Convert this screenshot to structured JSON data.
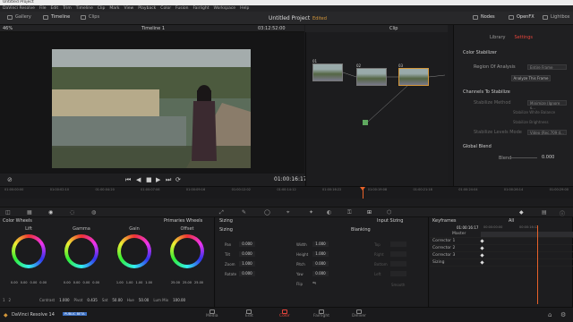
{
  "window": {
    "title": "Untitled Project"
  },
  "menu": [
    "DaVinci Resolve",
    "File",
    "Edit",
    "Trim",
    "Timeline",
    "Clip",
    "Mark",
    "View",
    "Playback",
    "Color",
    "Fusion",
    "Fairlight",
    "Workspace",
    "Help"
  ],
  "topbar": {
    "gallery": "Gallery",
    "timeline": "Timeline",
    "clips": "Clips",
    "project": "Untitled Project",
    "edited": "Edited",
    "nodes": "Nodes",
    "openfx": "OpenFX",
    "lightbox": "Lightbox"
  },
  "viewer": {
    "zoom": "46%",
    "timeline_name": "Timeline 1",
    "timecode_top": "03:12:52:00",
    "clip_label": "Clip",
    "timecode": "01:00:16:17"
  },
  "nodes": [
    {
      "num": "01"
    },
    {
      "num": "02"
    },
    {
      "num": "03"
    }
  ],
  "settings": {
    "tab_library": "Library",
    "tab_settings": "Settings",
    "fx_name": "Color Stabilizer",
    "region_label": "Region Of Analysis",
    "region_value": "Entire Frame",
    "analyze": "Analyze This Frame",
    "section_channels": "Channels To Stabilize",
    "method_label": "Stabilize Method",
    "method_value": "Minimize (Ignore s...",
    "opt1": "Stabilize White Balance",
    "opt2": "Stabilize Brightness",
    "levels_label": "Stabilize Levels Mode",
    "levels_value": "Video (Rec.709 d...",
    "section_global": "Global Blend",
    "blend_label": "Blend",
    "blend_value": "0.000"
  },
  "ruler": [
    "01:00:00:00",
    "01:00:02:10",
    "01:00:04:20",
    "01:00:07:06",
    "01:00:09:16",
    "01:00:12:02",
    "01:00:14:12",
    "01:00:16:22",
    "01:00:19:08",
    "01:00:21:18",
    "01:00:24:04",
    "01:00:26:14",
    "01:00:29:00"
  ],
  "colorwheels": {
    "title": "Color Wheels",
    "mode": "Primaries Wheels",
    "wheels": [
      {
        "name": "Lift",
        "vals": [
          "0.00",
          "0.00",
          "0.00",
          "0.00"
        ]
      },
      {
        "name": "Gamma",
        "vals": [
          "0.00",
          "0.00",
          "0.00",
          "0.00"
        ]
      },
      {
        "name": "Gain",
        "vals": [
          "1.00",
          "1.00",
          "1.00",
          "1.00"
        ]
      },
      {
        "name": "Offset",
        "vals": [
          "25.00",
          "25.00",
          "25.00"
        ]
      }
    ],
    "footer": [
      {
        "l": "Contrast",
        "v": "1.000"
      },
      {
        "l": "Pivot",
        "v": "0.435"
      },
      {
        "l": "Sat",
        "v": "50.00"
      },
      {
        "l": "Hue",
        "v": "50.00"
      },
      {
        "l": "Lum Mix",
        "v": "100.00"
      }
    ],
    "page1": "1",
    "page2": "2"
  },
  "sizing": {
    "title": "Sizing",
    "mode": "Input Sizing",
    "pan": "Pan",
    "pan_v": "0.000",
    "tilt": "Tilt",
    "tilt_v": "0.000",
    "zoom": "Zoom",
    "zoom_v": "1.000",
    "rotate": "Rotate",
    "rotate_v": "0.000",
    "width": "Width",
    "width_v": "1.000",
    "height": "Height",
    "height_v": "1.000",
    "pitch": "Pitch",
    "pitch_v": "0.000",
    "yaw": "Yaw",
    "yaw_v": "0.000",
    "flip": "Flip",
    "blanking": "Blanking",
    "top": "Top",
    "right": "Right",
    "bottom": "Bottom",
    "left": "Left",
    "smooth": "Smooth"
  },
  "keyframes": {
    "title": "Keyframes",
    "filter": "All",
    "timecode": "01:00:16:17",
    "t2": "00:00:00:00",
    "t3": "00:00:16:12",
    "master": "Master",
    "rows": [
      "Corrector 1",
      "Corrector 2",
      "Corrector 3",
      "Sizing"
    ]
  },
  "pages": {
    "app": "DaVinci Resolve 14",
    "beta": "PUBLIC BETA",
    "media": "Media",
    "edit": "Edit",
    "color": "Color",
    "fairlight": "Fairlight",
    "deliver": "Deliver"
  },
  "colors": {
    "accent": "#d4973a",
    "active_page": "#e8453c",
    "playhead": "#e8622a"
  }
}
